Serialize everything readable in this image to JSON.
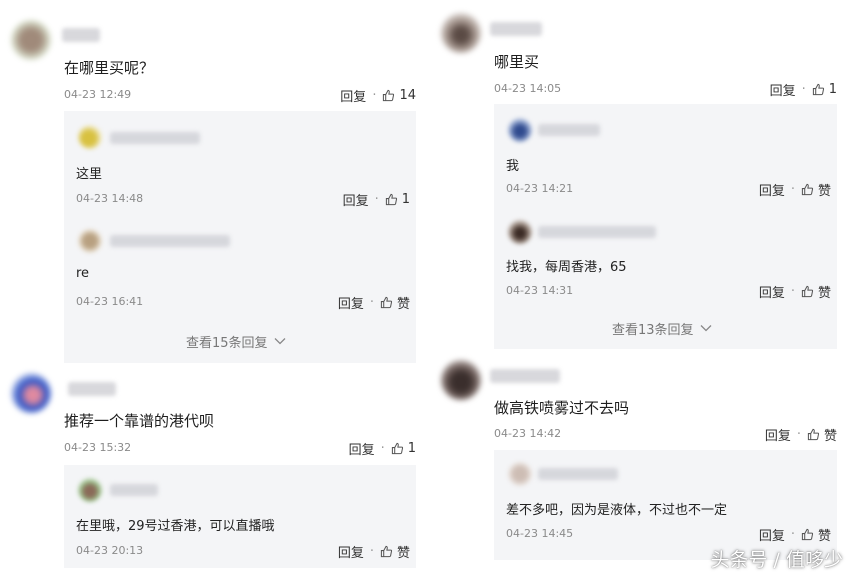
{
  "labels": {
    "reply": "回复",
    "separator": "·",
    "like": "赞"
  },
  "left": [
    {
      "text": "在哪里买呢？",
      "time": "04-23 12:49",
      "likes": "14",
      "avatar_color": "#b9a89a",
      "replies": [
        {
          "text": "这里",
          "time": "04-23 14:48",
          "likes": "1",
          "avatar_color": "#d9c56a"
        },
        {
          "text": "re",
          "time": "04-23 16:41",
          "likes": "赞",
          "avatar_color": "#c9b9a2"
        }
      ],
      "more": "查看15条回复"
    },
    {
      "text": "推荐一个靠谱的港代呗",
      "time": "04-23 15:32",
      "likes": "1",
      "avatar_color": "#3a5fc2",
      "replies": [
        {
          "text": "在里哦，29号过香港，可以直播哦",
          "time": "04-23 20:13",
          "likes": "赞",
          "avatar_color": "#8aa58a"
        }
      ]
    }
  ],
  "right": [
    {
      "text": "哪里买",
      "time": "04-23 14:05",
      "likes": "1",
      "avatar_color": "#9c8f88",
      "replies": [
        {
          "text": "我",
          "time": "04-23 14:21",
          "likes": "赞",
          "avatar_color": "#7d8fb8"
        },
        {
          "text": "找我，每周香港，65",
          "time": "04-23 14:31",
          "likes": "赞",
          "avatar_color": "#6e5e54"
        }
      ],
      "more": "查看13条回复"
    },
    {
      "text": "做高铁喷雾过不去吗",
      "time": "04-23 14:42",
      "likes": "赞",
      "avatar_color": "#5c4e4a",
      "replies": [
        {
          "text": "差不多吧，因为是液体，不过也不一定",
          "time": "04-23 14:45",
          "likes": "赞",
          "avatar_color": "#d7cbc4"
        }
      ]
    }
  ],
  "watermark": "头条号 / 值哆少"
}
